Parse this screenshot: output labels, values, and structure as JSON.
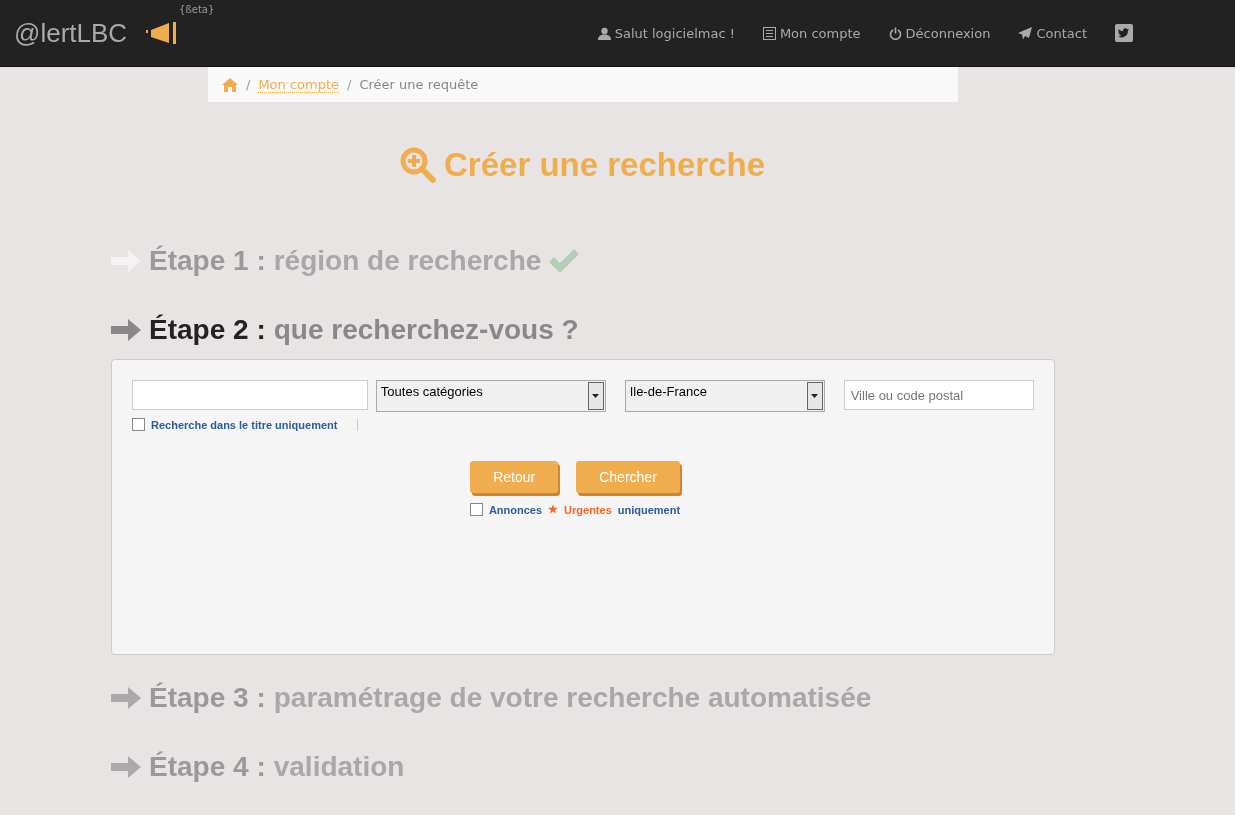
{
  "navbar": {
    "brand": "@lertLBC",
    "beta": "{ßeta}",
    "links": [
      {
        "kind": "user",
        "label": "Salut logicielmac !"
      },
      {
        "kind": "account",
        "label": "Mon compte"
      },
      {
        "kind": "logout",
        "label": "Déconnexion"
      },
      {
        "kind": "contact",
        "label": "Contact"
      },
      {
        "kind": "twitter"
      }
    ]
  },
  "breadcrumb": {
    "separator": "/",
    "items": [
      {
        "label": "Mon compte",
        "link": true
      },
      {
        "label": "Créer une requête",
        "link": false
      }
    ]
  },
  "page_title": "Créer une recherche",
  "steps": [
    {
      "label": "Étape 1 :",
      "text": "région de recherche",
      "selected": false,
      "completed": true
    },
    {
      "label": "Étape 2 :",
      "text": "que recherchez-vous ?",
      "selected": true,
      "completed": false
    },
    {
      "label": "Étape 3 :",
      "text": "paramétrage de votre recherche automatisée",
      "selected": false,
      "completed": false
    },
    {
      "label": "Étape 4 :",
      "text": "validation",
      "selected": false,
      "completed": false
    }
  ],
  "form": {
    "category": {
      "value": "Toutes catégories"
    },
    "region": {
      "value": "Ile-de-France"
    },
    "city": {
      "placeholder": "Ville ou code postal"
    },
    "title_only": {
      "label": "Recherche dans le titre uniquement",
      "checked": false
    },
    "buttons": [
      "Retour",
      "Chercher"
    ],
    "urgent_only": {
      "checked": false,
      "before": "Annonces",
      "star": "★",
      "urgent": "Urgentes",
      "after": "uniquement"
    }
  }
}
